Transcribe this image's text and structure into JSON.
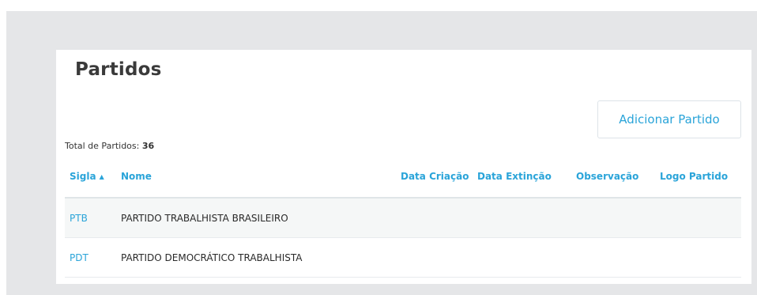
{
  "page": {
    "title": "Partidos",
    "add_button_label": "Adicionar Partido"
  },
  "summary": {
    "label": "Total de Partidos:",
    "count": "36"
  },
  "table": {
    "headers": {
      "sigla": "Sigla",
      "nome": "Nome",
      "data_criacao": "Data Criação",
      "data_extincao": "Data Extinção",
      "observacao": "Observação",
      "logo_partido": "Logo Partido"
    },
    "sort": {
      "column": "Sigla",
      "direction": "ascending",
      "icon": "sort-up-icon"
    },
    "rows": [
      {
        "sigla": "PTB",
        "nome": "PARTIDO TRABALHISTA BRASILEIRO"
      },
      {
        "sigla": "PDT",
        "nome": "PARTIDO DEMOCRÁTICO TRABALHISTA"
      }
    ]
  },
  "colors": {
    "accent": "#2aa4d9",
    "text": "#2a2a2a",
    "frame_background": "#e5e6e8",
    "row_alt_background": "#f5f7f7"
  }
}
